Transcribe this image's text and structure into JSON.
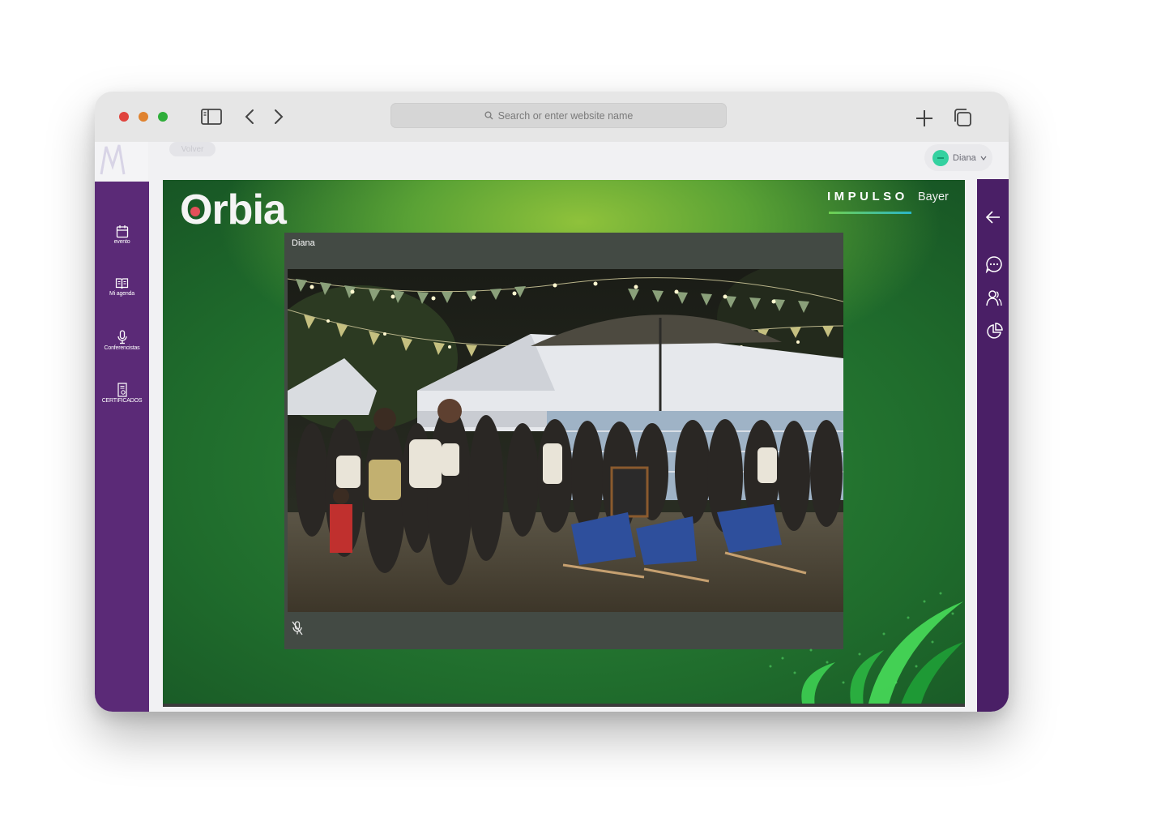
{
  "browser": {
    "address_placeholder": "Search or enter website name"
  },
  "header": {
    "back_label": "Volver",
    "user_name": "Diana"
  },
  "left_nav": {
    "items": [
      {
        "label": "evento",
        "icon": "calendar-icon"
      },
      {
        "label": "Mi agenda",
        "icon": "book-icon"
      },
      {
        "label": "Conferencistas",
        "icon": "microphone-icon"
      },
      {
        "label": "CERTIFICADOS",
        "icon": "certificate-icon"
      }
    ]
  },
  "right_nav": {
    "items": [
      {
        "icon": "arrow-left-icon"
      },
      {
        "icon": "chat-icon"
      },
      {
        "icon": "people-icon"
      },
      {
        "icon": "pie-chart-icon"
      }
    ]
  },
  "stage": {
    "brand": "Orbia",
    "partner_word": "IMPULSO",
    "partner_brand": "Bayer",
    "tile_name": "Diana",
    "mic_status": "muted"
  },
  "colors": {
    "sidebar_left": "#5b2a77",
    "sidebar_right": "#4a1f66",
    "stage_green": "#2e8a38",
    "avatar": "#34d1a0"
  }
}
